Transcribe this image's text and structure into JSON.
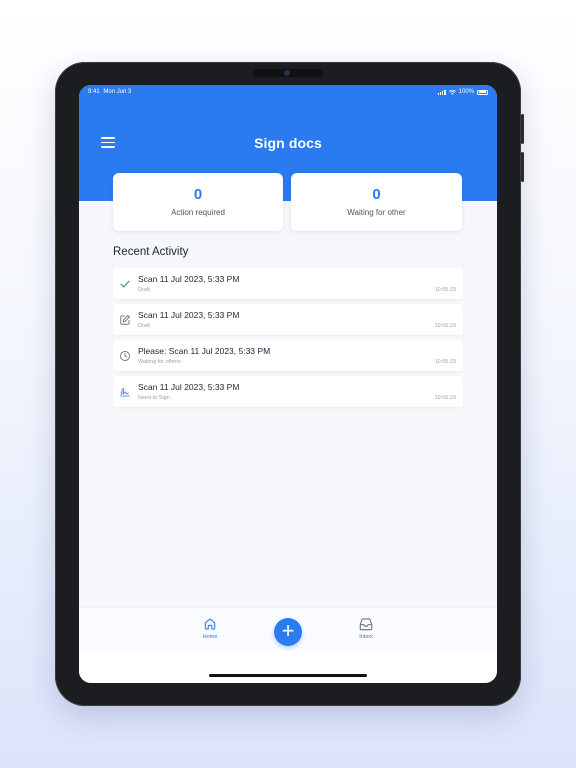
{
  "status_bar": {
    "time": "9:41",
    "date": "Mon Jun 3",
    "battery": "100%"
  },
  "header": {
    "title": "Sign docs"
  },
  "summary": {
    "action_required": {
      "count": "0",
      "label": "Action required"
    },
    "waiting_for_other": {
      "count": "0",
      "label": "Waiting for other"
    }
  },
  "recent": {
    "title": "Recent Activity",
    "items": [
      {
        "name": "Scan 11 Jul 2023, 5:33 PM",
        "status": "Draft",
        "time": "10:05:23",
        "icon": "check-icon"
      },
      {
        "name": "Scan 11 Jul 2023, 5:33 PM",
        "status": "Draft",
        "time": "10:05:23",
        "icon": "edit-icon"
      },
      {
        "name": "Please: Scan 11 Jul 2023, 5:33 PM",
        "status": "Waiting for others",
        "time": "10:05:23",
        "icon": "clock-icon"
      },
      {
        "name": "Scan 11 Jul 2023, 5:33 PM",
        "status": "Need to Sign",
        "time": "10:05:23",
        "icon": "signature-icon"
      }
    ]
  },
  "tabbar": {
    "home_label": "Home",
    "inbox_label": "Inbox",
    "add_symbol": "+"
  },
  "colors": {
    "accent": "#2a7bf0",
    "icon_gray": "#6b7280",
    "check_green": "#2e9e6a"
  }
}
